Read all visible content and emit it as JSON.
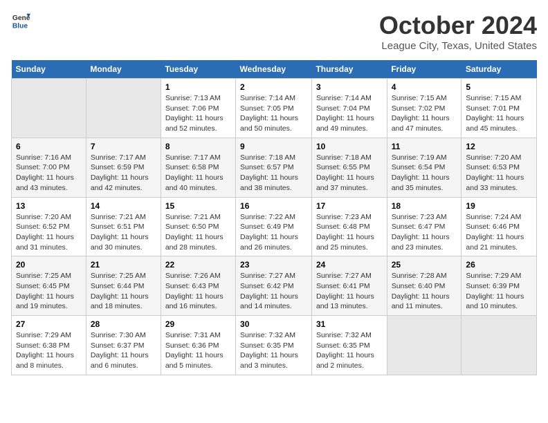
{
  "header": {
    "logo_line1": "General",
    "logo_line2": "Blue",
    "title": "October 2024",
    "subtitle": "League City, Texas, United States"
  },
  "days_of_week": [
    "Sunday",
    "Monday",
    "Tuesday",
    "Wednesday",
    "Thursday",
    "Friday",
    "Saturday"
  ],
  "weeks": [
    [
      {
        "num": "",
        "info": ""
      },
      {
        "num": "",
        "info": ""
      },
      {
        "num": "1",
        "info": "Sunrise: 7:13 AM\nSunset: 7:06 PM\nDaylight: 11 hours and 52 minutes."
      },
      {
        "num": "2",
        "info": "Sunrise: 7:14 AM\nSunset: 7:05 PM\nDaylight: 11 hours and 50 minutes."
      },
      {
        "num": "3",
        "info": "Sunrise: 7:14 AM\nSunset: 7:04 PM\nDaylight: 11 hours and 49 minutes."
      },
      {
        "num": "4",
        "info": "Sunrise: 7:15 AM\nSunset: 7:02 PM\nDaylight: 11 hours and 47 minutes."
      },
      {
        "num": "5",
        "info": "Sunrise: 7:15 AM\nSunset: 7:01 PM\nDaylight: 11 hours and 45 minutes."
      }
    ],
    [
      {
        "num": "6",
        "info": "Sunrise: 7:16 AM\nSunset: 7:00 PM\nDaylight: 11 hours and 43 minutes."
      },
      {
        "num": "7",
        "info": "Sunrise: 7:17 AM\nSunset: 6:59 PM\nDaylight: 11 hours and 42 minutes."
      },
      {
        "num": "8",
        "info": "Sunrise: 7:17 AM\nSunset: 6:58 PM\nDaylight: 11 hours and 40 minutes."
      },
      {
        "num": "9",
        "info": "Sunrise: 7:18 AM\nSunset: 6:57 PM\nDaylight: 11 hours and 38 minutes."
      },
      {
        "num": "10",
        "info": "Sunrise: 7:18 AM\nSunset: 6:55 PM\nDaylight: 11 hours and 37 minutes."
      },
      {
        "num": "11",
        "info": "Sunrise: 7:19 AM\nSunset: 6:54 PM\nDaylight: 11 hours and 35 minutes."
      },
      {
        "num": "12",
        "info": "Sunrise: 7:20 AM\nSunset: 6:53 PM\nDaylight: 11 hours and 33 minutes."
      }
    ],
    [
      {
        "num": "13",
        "info": "Sunrise: 7:20 AM\nSunset: 6:52 PM\nDaylight: 11 hours and 31 minutes."
      },
      {
        "num": "14",
        "info": "Sunrise: 7:21 AM\nSunset: 6:51 PM\nDaylight: 11 hours and 30 minutes."
      },
      {
        "num": "15",
        "info": "Sunrise: 7:21 AM\nSunset: 6:50 PM\nDaylight: 11 hours and 28 minutes."
      },
      {
        "num": "16",
        "info": "Sunrise: 7:22 AM\nSunset: 6:49 PM\nDaylight: 11 hours and 26 minutes."
      },
      {
        "num": "17",
        "info": "Sunrise: 7:23 AM\nSunset: 6:48 PM\nDaylight: 11 hours and 25 minutes."
      },
      {
        "num": "18",
        "info": "Sunrise: 7:23 AM\nSunset: 6:47 PM\nDaylight: 11 hours and 23 minutes."
      },
      {
        "num": "19",
        "info": "Sunrise: 7:24 AM\nSunset: 6:46 PM\nDaylight: 11 hours and 21 minutes."
      }
    ],
    [
      {
        "num": "20",
        "info": "Sunrise: 7:25 AM\nSunset: 6:45 PM\nDaylight: 11 hours and 19 minutes."
      },
      {
        "num": "21",
        "info": "Sunrise: 7:25 AM\nSunset: 6:44 PM\nDaylight: 11 hours and 18 minutes."
      },
      {
        "num": "22",
        "info": "Sunrise: 7:26 AM\nSunset: 6:43 PM\nDaylight: 11 hours and 16 minutes."
      },
      {
        "num": "23",
        "info": "Sunrise: 7:27 AM\nSunset: 6:42 PM\nDaylight: 11 hours and 14 minutes."
      },
      {
        "num": "24",
        "info": "Sunrise: 7:27 AM\nSunset: 6:41 PM\nDaylight: 11 hours and 13 minutes."
      },
      {
        "num": "25",
        "info": "Sunrise: 7:28 AM\nSunset: 6:40 PM\nDaylight: 11 hours and 11 minutes."
      },
      {
        "num": "26",
        "info": "Sunrise: 7:29 AM\nSunset: 6:39 PM\nDaylight: 11 hours and 10 minutes."
      }
    ],
    [
      {
        "num": "27",
        "info": "Sunrise: 7:29 AM\nSunset: 6:38 PM\nDaylight: 11 hours and 8 minutes."
      },
      {
        "num": "28",
        "info": "Sunrise: 7:30 AM\nSunset: 6:37 PM\nDaylight: 11 hours and 6 minutes."
      },
      {
        "num": "29",
        "info": "Sunrise: 7:31 AM\nSunset: 6:36 PM\nDaylight: 11 hours and 5 minutes."
      },
      {
        "num": "30",
        "info": "Sunrise: 7:32 AM\nSunset: 6:35 PM\nDaylight: 11 hours and 3 minutes."
      },
      {
        "num": "31",
        "info": "Sunrise: 7:32 AM\nSunset: 6:35 PM\nDaylight: 11 hours and 2 minutes."
      },
      {
        "num": "",
        "info": ""
      },
      {
        "num": "",
        "info": ""
      }
    ]
  ]
}
